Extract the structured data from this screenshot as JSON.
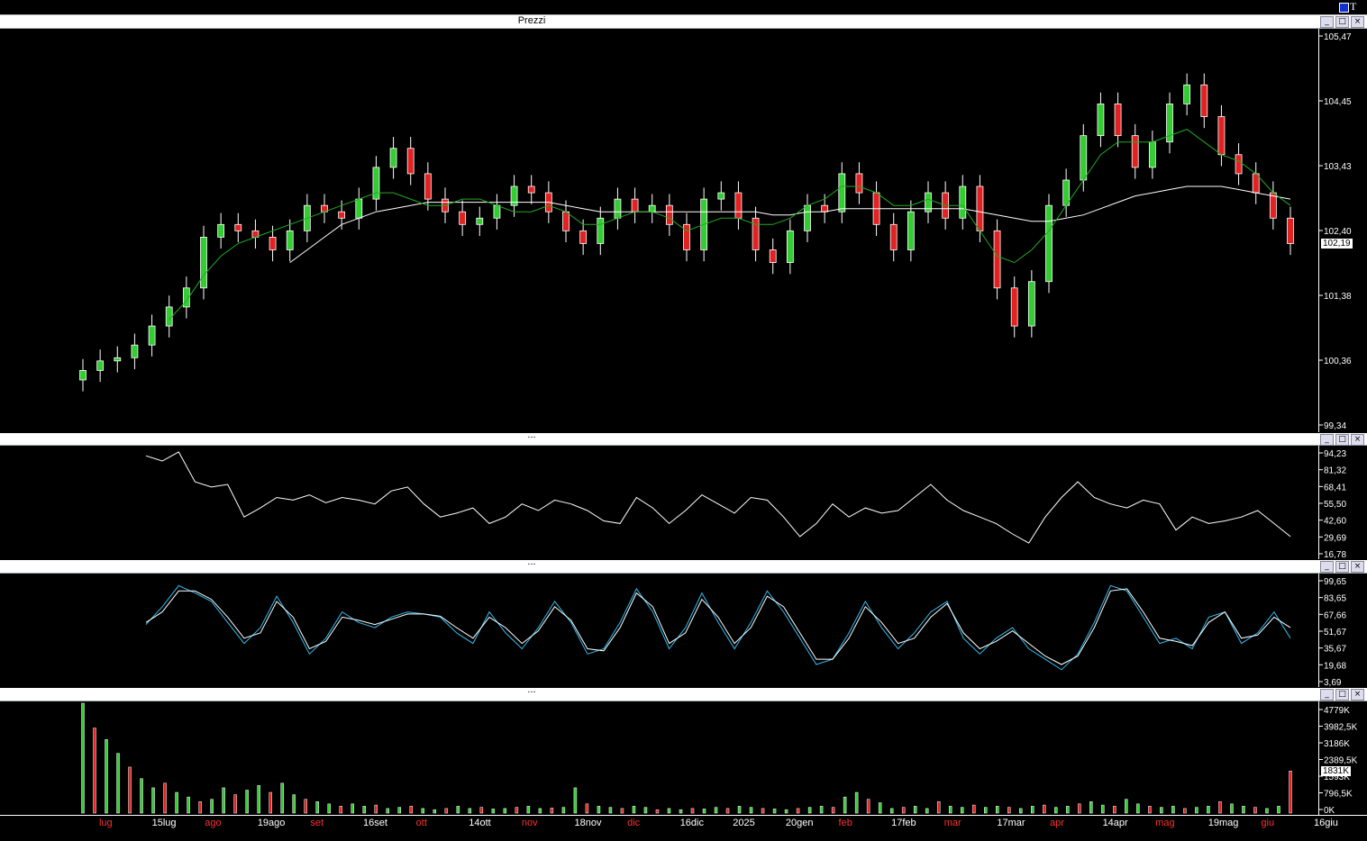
{
  "window": {
    "title_glyph": "T"
  },
  "panels": {
    "price_title": "Prezzi",
    "osc1_title": "...",
    "osc2_title": "...",
    "vol_title": "...",
    "btn_min": "_",
    "btn_restore": "□",
    "btn_close": "×"
  },
  "colors": {
    "up": "#33cc33",
    "down": "#e22222",
    "ma_short": "#22aa22",
    "ma_long": "#ffffff",
    "ma_red": "#cc2222",
    "stoch_k": "#33bbee",
    "stoch_d": "#ffffff",
    "background": "#000000"
  },
  "chart_data": [
    {
      "type": "candlestick",
      "title": "Prezzi",
      "y_ticks": [
        "105,47",
        "104,45",
        "103,43",
        "102,40",
        "101,38",
        "100,36",
        "99,34"
      ],
      "ylim": [
        99.34,
        105.47
      ],
      "last_price": "102,19",
      "series": [
        {
          "name": "close",
          "values": [
            100.2,
            100.35,
            100.4,
            100.6,
            100.9,
            101.2,
            101.5,
            102.3,
            102.5,
            102.4,
            102.3,
            102.1,
            102.4,
            102.8,
            102.7,
            102.6,
            102.9,
            103.4,
            103.7,
            103.3,
            102.9,
            102.7,
            102.5,
            102.6,
            102.8,
            103.1,
            103.0,
            102.7,
            102.4,
            102.2,
            102.6,
            102.9,
            102.7,
            102.8,
            102.5,
            102.1,
            102.9,
            103.0,
            102.6,
            102.1,
            101.9,
            102.4,
            102.8,
            102.7,
            103.3,
            103.0,
            102.5,
            102.1,
            102.7,
            103.0,
            102.6,
            103.1,
            102.4,
            101.5,
            100.9,
            101.6,
            102.8,
            103.2,
            103.9,
            104.4,
            103.9,
            103.4,
            103.8,
            104.4,
            104.7,
            104.2,
            103.6,
            103.3,
            103.0,
            102.6,
            102.2
          ]
        },
        {
          "name": "MA short",
          "values": [
            null,
            null,
            null,
            null,
            null,
            101.0,
            101.3,
            101.7,
            102.0,
            102.2,
            102.3,
            102.4,
            102.5,
            102.6,
            102.7,
            102.8,
            102.9,
            103.0,
            103.0,
            102.9,
            102.8,
            102.8,
            102.9,
            102.9,
            102.8,
            102.7,
            102.7,
            102.8,
            102.7,
            102.5,
            102.5,
            102.6,
            102.7,
            102.7,
            102.6,
            102.4,
            102.5,
            102.6,
            102.6,
            102.5,
            102.5,
            102.6,
            102.8,
            102.9,
            103.1,
            103.1,
            103.0,
            102.8,
            102.8,
            102.9,
            102.8,
            102.8,
            102.4,
            102.0,
            101.9,
            102.1,
            102.4,
            102.8,
            103.2,
            103.6,
            103.8,
            103.8,
            103.8,
            103.9,
            104.0,
            103.8,
            103.6,
            103.5,
            103.3,
            103.0,
            102.8
          ]
        },
        {
          "name": "MA long",
          "values": [
            null,
            null,
            null,
            null,
            null,
            null,
            null,
            null,
            null,
            null,
            null,
            null,
            101.9,
            102.1,
            102.3,
            102.5,
            102.6,
            102.7,
            102.75,
            102.8,
            102.85,
            102.85,
            102.85,
            102.85,
            102.85,
            102.85,
            102.85,
            102.85,
            102.8,
            102.75,
            102.7,
            102.7,
            102.7,
            102.7,
            102.7,
            102.7,
            102.7,
            102.7,
            102.7,
            102.7,
            102.65,
            102.65,
            102.7,
            102.7,
            102.75,
            102.75,
            102.75,
            102.75,
            102.75,
            102.75,
            102.75,
            102.75,
            102.7,
            102.65,
            102.6,
            102.55,
            102.55,
            102.6,
            102.65,
            102.75,
            102.85,
            102.95,
            103.0,
            103.05,
            103.1,
            103.1,
            103.1,
            103.05,
            103.0,
            102.95,
            102.9
          ]
        }
      ]
    },
    {
      "type": "line",
      "title": "",
      "y_ticks": [
        "94,23",
        "81,32",
        "68,41",
        "55,50",
        "42,60",
        "29,69",
        "16,78"
      ],
      "ylim": [
        16.78,
        94.23
      ],
      "series": [
        {
          "name": "",
          "values": [
            92,
            88,
            95,
            72,
            68,
            70,
            45,
            52,
            60,
            58,
            62,
            56,
            60,
            58,
            55,
            65,
            68,
            55,
            45,
            48,
            52,
            40,
            45,
            55,
            50,
            58,
            55,
            50,
            42,
            40,
            60,
            52,
            40,
            50,
            62,
            55,
            48,
            60,
            58,
            45,
            30,
            40,
            55,
            45,
            52,
            48,
            50,
            60,
            70,
            58,
            50,
            45,
            40,
            32,
            25,
            45,
            60,
            72,
            60,
            55,
            52,
            58,
            55,
            35,
            45,
            40,
            42,
            45,
            50,
            40,
            30
          ]
        }
      ]
    },
    {
      "type": "line",
      "title": "",
      "y_ticks": [
        "99,65",
        "83,65",
        "67,66",
        "51,67",
        "35,67",
        "19,68",
        "3,69"
      ],
      "ylim": [
        3.69,
        99.65
      ],
      "series": [
        {
          "name": "",
          "values": [
            58,
            75,
            95,
            88,
            80,
            60,
            40,
            55,
            85,
            60,
            30,
            45,
            70,
            60,
            55,
            65,
            70,
            68,
            65,
            50,
            40,
            70,
            50,
            35,
            55,
            80,
            60,
            30,
            35,
            60,
            92,
            70,
            35,
            55,
            88,
            60,
            35,
            60,
            90,
            70,
            45,
            20,
            25,
            50,
            80,
            55,
            35,
            50,
            70,
            80,
            45,
            30,
            45,
            55,
            35,
            25,
            15,
            30,
            60,
            95,
            90,
            65,
            40,
            45,
            35,
            65,
            70,
            40,
            50,
            70,
            45
          ]
        },
        {
          "name": "",
          "values": [
            60,
            70,
            90,
            90,
            82,
            65,
            45,
            50,
            80,
            65,
            35,
            42,
            65,
            62,
            58,
            63,
            68,
            68,
            66,
            55,
            45,
            65,
            55,
            40,
            52,
            75,
            62,
            35,
            33,
            55,
            88,
            75,
            40,
            50,
            82,
            65,
            40,
            55,
            85,
            75,
            50,
            25,
            25,
            45,
            75,
            60,
            40,
            45,
            65,
            78,
            50,
            35,
            42,
            52,
            40,
            28,
            20,
            28,
            55,
            90,
            92,
            70,
            45,
            42,
            38,
            60,
            70,
            45,
            48,
            65,
            55
          ]
        }
      ]
    },
    {
      "type": "bar",
      "title": "",
      "y_ticks": [
        "4779K",
        "3982,5K",
        "3186K",
        "2389,5K",
        "1593K",
        "796,5K",
        "0K"
      ],
      "ylim": [
        0,
        4779
      ],
      "last_volume": "1831K",
      "values": [
        4779,
        3700,
        3200,
        2600,
        2000,
        1500,
        1100,
        1300,
        900,
        700,
        500,
        600,
        1100,
        800,
        1000,
        1200,
        900,
        1300,
        800,
        600,
        500,
        400,
        300,
        400,
        300,
        350,
        200,
        250,
        300,
        200,
        150,
        200,
        300,
        200,
        250,
        180,
        200,
        250,
        300,
        200,
        220,
        250,
        1100,
        400,
        300,
        250,
        200,
        300,
        250,
        150,
        200,
        150,
        200,
        180,
        250,
        200,
        300,
        250,
        200,
        180,
        150,
        200,
        250,
        300,
        250,
        700,
        900,
        600,
        450,
        200,
        250,
        300,
        200,
        500,
        300,
        250,
        350,
        250,
        300,
        250,
        200,
        300,
        350,
        250,
        300,
        400,
        500,
        350,
        300,
        600,
        400,
        300,
        250,
        300,
        200,
        250,
        300,
        500,
        400,
        300,
        250,
        200,
        300,
        1831
      ]
    }
  ],
  "x_axis": {
    "labels": [
      {
        "text": "lug",
        "red": true
      },
      {
        "text": "15lug",
        "red": false
      },
      {
        "text": "ago",
        "red": true
      },
      {
        "text": "19ago",
        "red": false
      },
      {
        "text": "set",
        "red": true
      },
      {
        "text": "16set",
        "red": false
      },
      {
        "text": "ott",
        "red": true
      },
      {
        "text": "14ott",
        "red": false
      },
      {
        "text": "nov",
        "red": true
      },
      {
        "text": "18nov",
        "red": false
      },
      {
        "text": "dic",
        "red": true
      },
      {
        "text": "16dic",
        "red": false
      },
      {
        "text": "2025",
        "red": false
      },
      {
        "text": "20gen",
        "red": false
      },
      {
        "text": "feb",
        "red": true
      },
      {
        "text": "17feb",
        "red": false
      },
      {
        "text": "mar",
        "red": true
      },
      {
        "text": "17mar",
        "red": false
      },
      {
        "text": "apr",
        "red": true
      },
      {
        "text": "14apr",
        "red": false
      },
      {
        "text": "mag",
        "red": true
      },
      {
        "text": "19mag",
        "red": false
      },
      {
        "text": "giu",
        "red": true
      },
      {
        "text": "16giu",
        "red": false
      }
    ]
  }
}
